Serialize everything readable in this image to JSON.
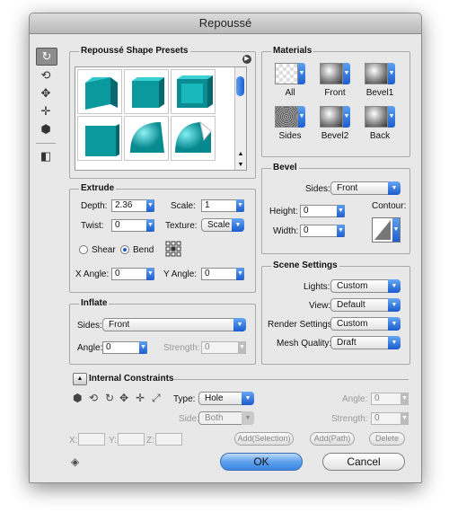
{
  "window": {
    "title": "Repoussé"
  },
  "toolbar": {
    "icons": [
      "bend-tool-icon",
      "rotate-tool-icon",
      "drag-tool-icon",
      "slide-tool-icon",
      "scale-tool-icon",
      "camera-tool-icon"
    ]
  },
  "presets": {
    "title": "Repoussé Shape Presets"
  },
  "materials": {
    "title": "Materials",
    "items": [
      {
        "label": "All"
      },
      {
        "label": "Front"
      },
      {
        "label": "Bevel1"
      },
      {
        "label": "Sides"
      },
      {
        "label": "Bevel2"
      },
      {
        "label": "Back"
      }
    ]
  },
  "extrude": {
    "title": "Extrude",
    "depth_label": "Depth:",
    "depth_value": "2.36",
    "scale_label": "Scale:",
    "scale_value": "1",
    "twist_label": "Twist:",
    "twist_value": "0",
    "texture_label": "Texture:",
    "texture_value": "Scale",
    "shear_label": "Shear",
    "bend_label": "Bend",
    "xangle_label": "X Angle:",
    "xangle_value": "0",
    "yangle_label": "Y Angle:",
    "yangle_value": "0"
  },
  "bevel": {
    "title": "Bevel",
    "sides_label": "Sides:",
    "sides_value": "Front",
    "height_label": "Height:",
    "height_value": "0",
    "width_label": "Width:",
    "width_value": "0",
    "contour_label": "Contour:"
  },
  "inflate": {
    "title": "Inflate",
    "sides_label": "Sides:",
    "sides_value": "Front",
    "angle_label": "Angle:",
    "angle_value": "0",
    "strength_label": "Strength:",
    "strength_value": "0"
  },
  "scene": {
    "title": "Scene Settings",
    "lights_label": "Lights:",
    "lights_value": "Custom",
    "view_label": "View:",
    "view_value": "Default",
    "render_label": "Render Settings:",
    "render_value": "Custom",
    "mesh_label": "Mesh Quality:",
    "mesh_value": "Draft"
  },
  "constraints": {
    "title": "Internal Constraints",
    "type_label": "Type:",
    "type_value": "Hole",
    "side_label": "Side:",
    "side_value": "Both",
    "angle_label": "Angle:",
    "angle_value": "0",
    "strength_label": "Strength:",
    "strength_value": "0",
    "x_label": "X:",
    "y_label": "Y:",
    "z_label": "Z:",
    "add_selection": "Add(Selection)",
    "add_path": "Add(Path)",
    "delete": "Delete"
  },
  "buttons": {
    "ok": "OK",
    "cancel": "Cancel"
  }
}
